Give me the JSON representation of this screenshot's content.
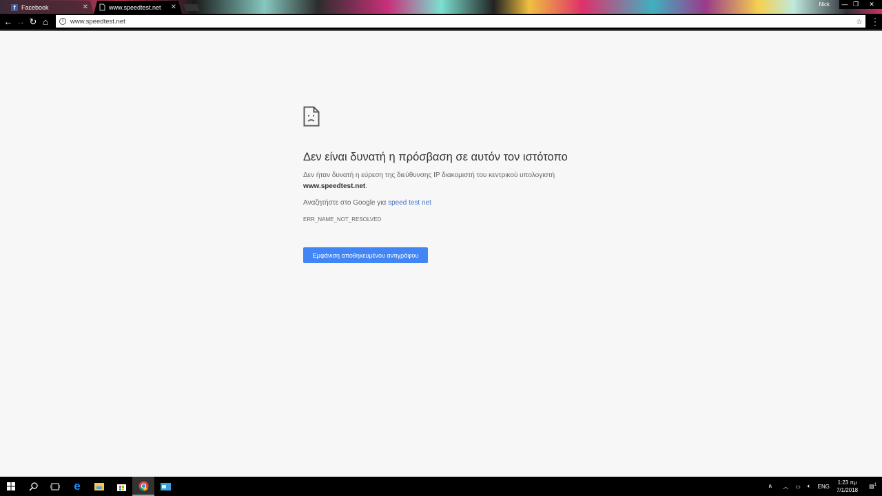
{
  "browser": {
    "tabs": [
      {
        "label": "Facebook",
        "icon": "facebook-icon"
      },
      {
        "label": "www.speedtest.net",
        "icon": "page-icon"
      }
    ],
    "profile_name": "Nick",
    "url": "www.speedtest.net"
  },
  "error_page": {
    "icon_label": "sad-page",
    "title": "Δεν είναι δυνατή η πρόσβαση σε αυτόν τον ιστότοπο",
    "description": "Δεν ήταν δυνατή η εύρεση της διεύθυνσης IP διακομιστή του κεντρικού υπολογιστή",
    "host": "www.speedtest.net",
    "host_suffix": ".",
    "search_prefix": "Αναζητήστε στο Google για ",
    "search_link": "speed test net",
    "error_code": "ERR_NAME_NOT_RESOLVED",
    "button_label": "Εμφάνιση αποθηκευμένου αντιγράφου",
    "accent": "#4285f4"
  },
  "taskbar": {
    "language": "ENG",
    "time": "1:23 πμ",
    "date": "7/1/2018",
    "notifications": "1"
  }
}
